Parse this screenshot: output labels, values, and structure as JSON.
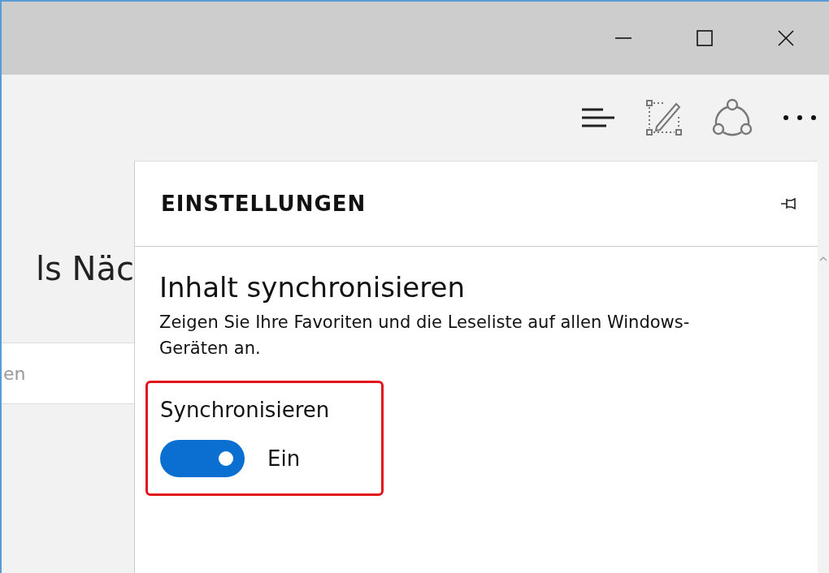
{
  "window": {
    "controls": [
      {
        "kind": "minimize"
      },
      {
        "kind": "maximize"
      },
      {
        "kind": "close"
      }
    ]
  },
  "toolbar": [
    {
      "kind": "hub"
    },
    {
      "kind": "note"
    },
    {
      "kind": "share"
    },
    {
      "kind": "more"
    }
  ],
  "page": {
    "heading": "ls Näc",
    "field": {
      "placeholder": "en"
    }
  },
  "settings": {
    "title": "EINSTELLUNGEN",
    "section_title": "Inhalt synchronisieren",
    "description": "Zeigen Sie Ihre Favoriten und die Leseliste auf allen Windows-Geräten an.",
    "toggle": {
      "label": "Synchronisieren",
      "on": true,
      "state_text": "Ein",
      "highlighted": true
    }
  }
}
